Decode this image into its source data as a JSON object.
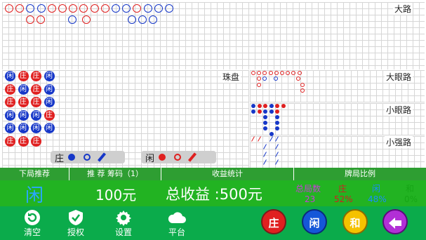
{
  "roads": {
    "big_road": {
      "label": "大路"
    },
    "bead_plate": {
      "label": "珠盘"
    },
    "big_eye": {
      "label": "大眼路"
    },
    "small": {
      "label": "小眼路"
    },
    "cockroach": {
      "label": "小强路"
    }
  },
  "bead_plate_rows": [
    [
      "闲",
      "庄",
      "庄",
      "闲"
    ],
    [
      "庄",
      "闲",
      "庄",
      "闲"
    ],
    [
      "庄",
      "庄",
      "庄",
      "闲"
    ],
    [
      "闲",
      "闲",
      "闲",
      "庄"
    ],
    [
      "闲",
      "闲",
      "闲",
      "闲"
    ],
    [
      "庄",
      "庄",
      "庄"
    ]
  ],
  "predict": {
    "banker": {
      "label": "庄"
    },
    "player": {
      "label": "闲"
    }
  },
  "stats_header": {
    "next_hand": "下局推荐",
    "chips": "推 荐 筹码（1）",
    "profit": "收益统计",
    "ratio": "牌局比例"
  },
  "stats": {
    "next_value": "闲",
    "chip_amount": "100元",
    "total_profit": "总收益 :500元",
    "total_hands_label": "总局数",
    "total_hands": "23",
    "banker_label": "庄",
    "banker_pct": "52%",
    "player_label": "闲",
    "player_pct": "48%",
    "tie_label": "和",
    "tie_pct": "0%"
  },
  "toolbar": {
    "clear": "清空",
    "auth": "授权",
    "settings": "设置",
    "platform": "平台"
  },
  "buttons": {
    "banker": "庄",
    "player": "闲",
    "tie": "和"
  },
  "colors": {
    "banker": "#e02020",
    "player": "#1637c8",
    "tie": "#f5c200",
    "back": "#b22fd6",
    "bar": "#22b322"
  }
}
